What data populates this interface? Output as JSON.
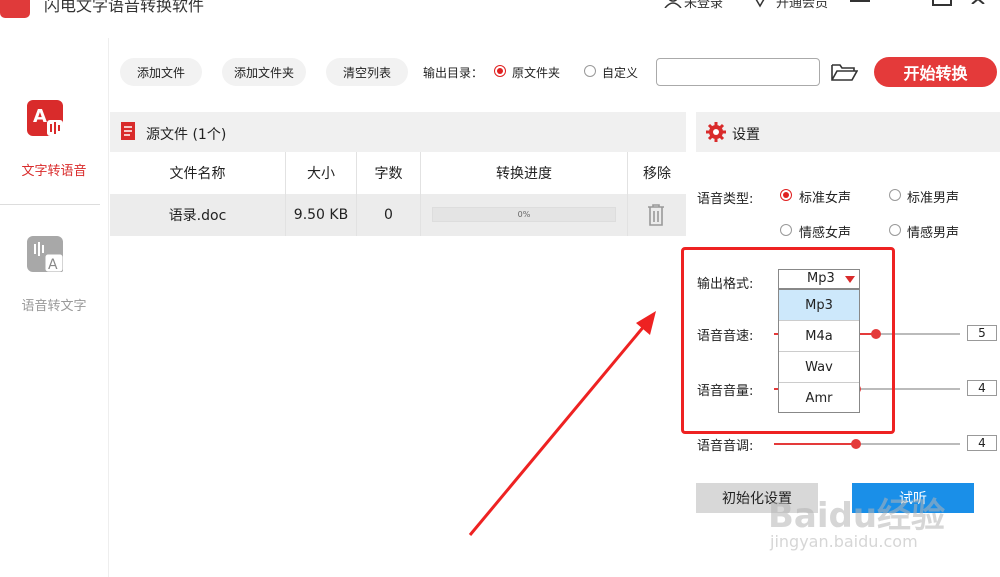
{
  "app": {
    "title": "闪电文字语音转换软件",
    "login": "未登录",
    "vip": "开通会员"
  },
  "nav": {
    "items": [
      {
        "label": "文字转语音"
      },
      {
        "label": "语音转文字"
      }
    ]
  },
  "toolbar": {
    "add_file": "添加文件",
    "add_folder": "添加文件夹",
    "clear_list": "清空列表",
    "output_dir_label": "输出目录：",
    "option_source": "原文件夹",
    "option_custom": "自定义",
    "dir_value": "",
    "start": "开始转换"
  },
  "files": {
    "header": "源文件 (1个)",
    "columns": [
      "文件名称",
      "大小",
      "字数",
      "转换进度",
      "移除"
    ],
    "rows": [
      {
        "name": "语录.doc",
        "size": "9.50 KB",
        "words": "0",
        "progress": "0%"
      }
    ]
  },
  "settings": {
    "title": "设置",
    "voice_type_label": "语音类型:",
    "voices": [
      "标准女声",
      "标准男声",
      "情感女声",
      "情感男声"
    ],
    "output_format_label": "输出格式:",
    "format_selected": "Mp3",
    "format_options": [
      "Mp3",
      "M4a",
      "Wav",
      "Amr"
    ],
    "speed_label": "语音音速:",
    "speed": "5",
    "volume_label": "语音音量:",
    "volume": "4",
    "pitch_label": "语音音调:",
    "pitch": "4",
    "init_button": "初始化设置",
    "try_button": "试听"
  },
  "watermark": {
    "brand": "Baidu经验",
    "url": "jingyan.baidu.com"
  },
  "colors": {
    "accent": "#e43a3a",
    "highlight": "#ee2222",
    "blue": "#1a8fe8"
  }
}
